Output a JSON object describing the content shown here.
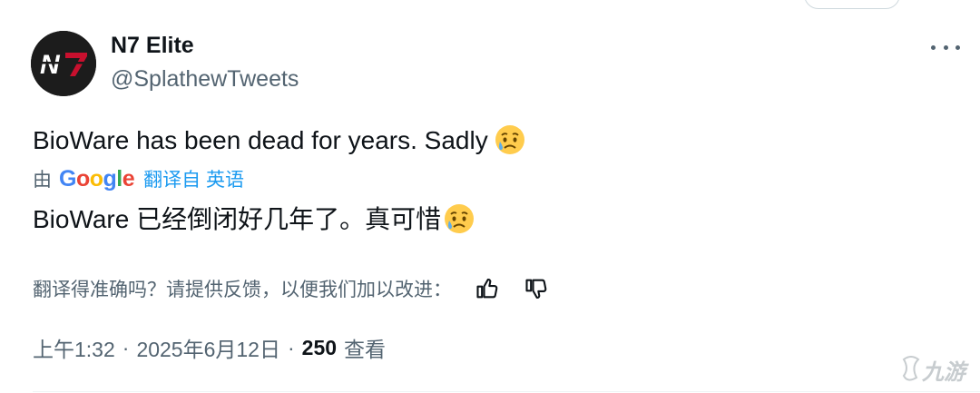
{
  "tweet": {
    "display_name": "N7 Elite",
    "handle": "@SplathewTweets",
    "avatar_text": "N7",
    "text": "BioWare has been dead for years. Sadly",
    "text_emoji": "sad-but-relieved-face",
    "translation": {
      "by_label": "由",
      "provider": "Google",
      "link_label": "翻译自 英语",
      "text": "BioWare 已经倒闭好几年了。真可惜"
    },
    "feedback": {
      "prompt": "翻译得准确吗？请提供反馈，以便我们加以改进：",
      "thumbs_up_icon": "thumbs-up-icon",
      "thumbs_down_icon": "thumbs-down-icon"
    },
    "meta": {
      "time": "上午1:32",
      "separator": "·",
      "date": "2025年6月12日",
      "views_count": "250",
      "views_label": "查看"
    }
  },
  "watermark": {
    "text": "九游"
  },
  "colors": {
    "text_primary": "#0f1419",
    "text_secondary": "#536471",
    "link": "#1d9bf0",
    "google_blue": "#4285f4",
    "google_red": "#ea4335",
    "google_yellow": "#fbbc05",
    "google_green": "#34a853"
  }
}
